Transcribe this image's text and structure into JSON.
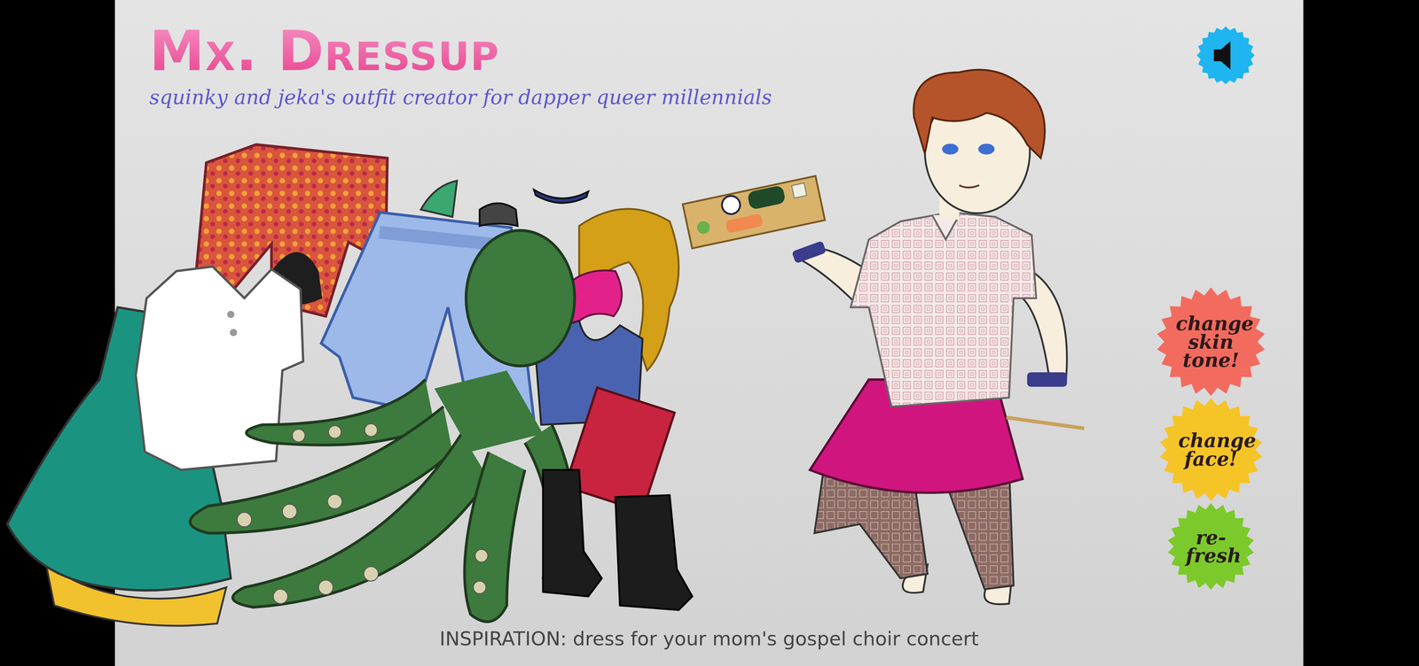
{
  "game": {
    "title": "Mx. Dressup",
    "subtitle": "squinky and jeka's outfit creator for dapper queer millennials"
  },
  "buttons": [
    {
      "label": "change skin tone!",
      "color": "#f26b5e"
    },
    {
      "label": "change face!",
      "color": "#f5c427"
    },
    {
      "label": "re-fresh",
      "color": "#7cc92c"
    }
  ],
  "inspiration": "INSPIRATION: dress for your mom's gospel choir concert"
}
